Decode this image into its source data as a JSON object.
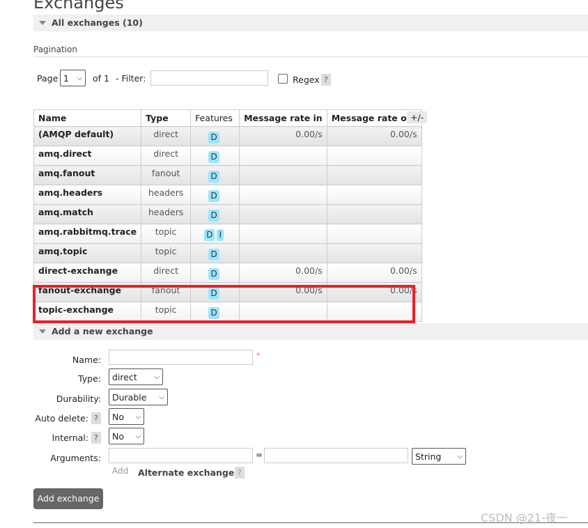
{
  "page_title": "Exchanges",
  "all_section": "All exchanges (10)",
  "pagination": {
    "label": "Pagination",
    "page_label": "Page",
    "page_value": "1",
    "of_label": "of 1",
    "filter_label": "- Filter:",
    "filter_value": "",
    "regex_label": "Regex",
    "help": "?"
  },
  "table": {
    "headers": [
      "Name",
      "Type",
      "Features",
      "Message rate in",
      "Message rate out"
    ],
    "toggle": "+/-",
    "rows": [
      {
        "name": "(AMQP default)",
        "type": "direct",
        "features": [
          "D"
        ],
        "in": "0.00/s",
        "out": "0.00/s"
      },
      {
        "name": "amq.direct",
        "type": "direct",
        "features": [
          "D"
        ],
        "in": "",
        "out": ""
      },
      {
        "name": "amq.fanout",
        "type": "fanout",
        "features": [
          "D"
        ],
        "in": "",
        "out": ""
      },
      {
        "name": "amq.headers",
        "type": "headers",
        "features": [
          "D"
        ],
        "in": "",
        "out": ""
      },
      {
        "name": "amq.match",
        "type": "headers",
        "features": [
          "D"
        ],
        "in": "",
        "out": ""
      },
      {
        "name": "amq.rabbitmq.trace",
        "type": "topic",
        "features": [
          "D",
          "I"
        ],
        "in": "",
        "out": ""
      },
      {
        "name": "amq.topic",
        "type": "topic",
        "features": [
          "D"
        ],
        "in": "",
        "out": ""
      },
      {
        "name": "direct-exchange",
        "type": "direct",
        "features": [
          "D"
        ],
        "in": "0.00/s",
        "out": "0.00/s"
      },
      {
        "name": "fanout-exchange",
        "type": "fanout",
        "features": [
          "D"
        ],
        "in": "0.00/s",
        "out": "0.00/s"
      },
      {
        "name": "topic-exchange",
        "type": "topic",
        "features": [
          "D"
        ],
        "in": "",
        "out": ""
      }
    ]
  },
  "add_section": "Add a new exchange",
  "form": {
    "name_label": "Name:",
    "name_value": "",
    "required": "*",
    "type_label": "Type:",
    "type_value": "direct",
    "durability_label": "Durability:",
    "durability_value": "Durable",
    "auto_delete_label": "Auto delete:",
    "auto_delete_value": "No",
    "internal_label": "Internal:",
    "internal_value": "No",
    "arguments_label": "Arguments:",
    "eq": "=",
    "arg_type": "String",
    "add_label": "Add",
    "alternate_label": "Alternate exchange",
    "help": "?",
    "submit": "Add exchange"
  },
  "watermark": "CSDN @21-夜一",
  "highlight_color": "#e5212b"
}
